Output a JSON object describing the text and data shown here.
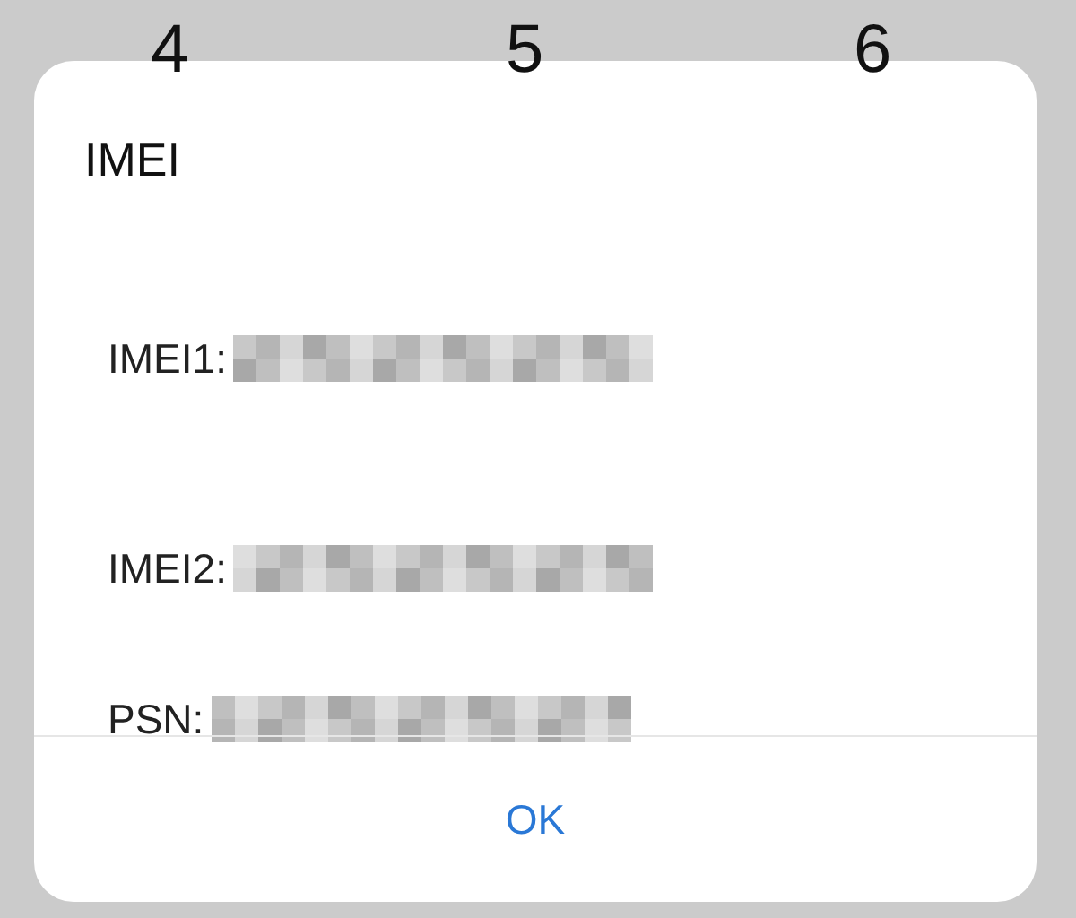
{
  "keypad": [
    "4",
    "5",
    "6"
  ],
  "dialog": {
    "title": "IMEI",
    "rows": [
      {
        "label": "IMEI1:"
      },
      {
        "label": "IMEI2:"
      },
      {
        "label": "PSN:"
      }
    ],
    "buttons": [
      "OK"
    ]
  }
}
